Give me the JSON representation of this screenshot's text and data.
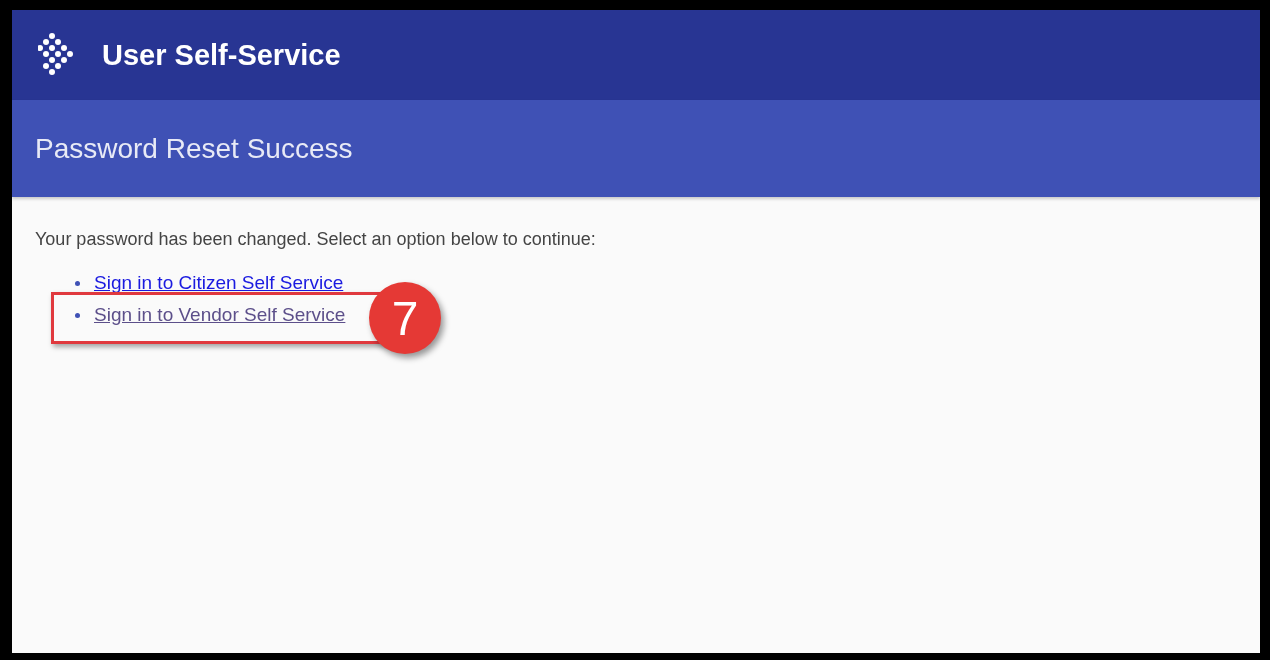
{
  "header": {
    "title": "User Self-Service"
  },
  "subheader": {
    "title": "Password Reset Success"
  },
  "message": "Your password has been changed. Select an option below to continue:",
  "links": [
    {
      "label": "Sign in to Citizen Self Service",
      "visited": false,
      "highlighted": false
    },
    {
      "label": "Sign in to Vendor Self Service",
      "visited": true,
      "highlighted": true,
      "callout": "7"
    }
  ]
}
